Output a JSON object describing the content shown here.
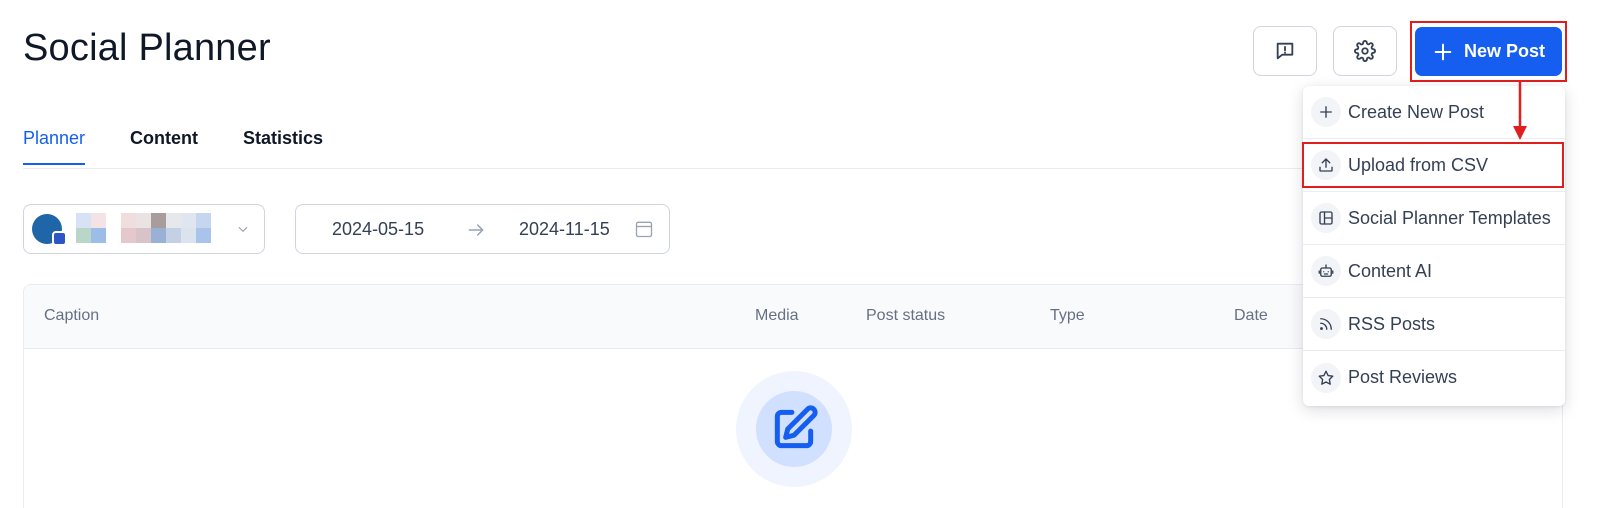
{
  "header": {
    "title": "Social Planner",
    "new_post_label": "New Post"
  },
  "tabs": [
    {
      "label": "Planner",
      "active": true
    },
    {
      "label": "Content",
      "active": false
    },
    {
      "label": "Statistics",
      "active": false
    }
  ],
  "filters": {
    "date_start": "2024-05-15",
    "date_end": "2024-11-15"
  },
  "table": {
    "columns": [
      "Caption",
      "Media",
      "Post status",
      "Type",
      "Date"
    ]
  },
  "new_post_menu": {
    "items": [
      {
        "label": "Create New Post",
        "icon": "plus-icon"
      },
      {
        "label": "Upload from CSV",
        "icon": "upload-icon",
        "highlighted": true
      },
      {
        "label": "Social Planner Templates",
        "icon": "template-icon"
      },
      {
        "label": "Content AI",
        "icon": "robot-icon"
      },
      {
        "label": "RSS Posts",
        "icon": "rss-icon"
      },
      {
        "label": "Post Reviews",
        "icon": "star-icon"
      }
    ]
  },
  "colors": {
    "accent": "#155eef",
    "highlight_border": "#e01e1e"
  }
}
